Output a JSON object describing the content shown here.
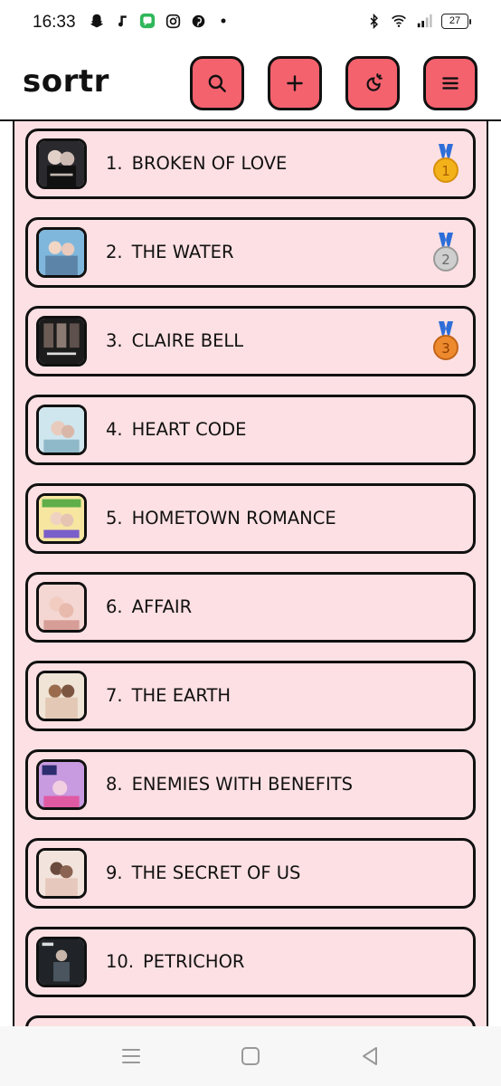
{
  "status": {
    "time": "16:33",
    "battery": "27",
    "left_icons": [
      "snapchat-icon",
      "music-note-icon",
      "messages-icon",
      "instagram-icon",
      "pinterest-icon",
      "dot-icon"
    ],
    "right_icons": [
      "bluetooth-icon",
      "wifi-icon",
      "signal-icon",
      "battery-icon"
    ]
  },
  "header": {
    "logo": "sortr",
    "buttons": [
      "search-icon",
      "plus-icon",
      "theme-icon",
      "menu-icon"
    ],
    "accent": "#f4626e"
  },
  "list": {
    "background": "#fde0e3",
    "items": [
      {
        "rank": "1.",
        "title": "BROKEN OF LOVE",
        "medal": "gold-medal-icon"
      },
      {
        "rank": "2.",
        "title": "THE WATER",
        "medal": "silver-medal-icon"
      },
      {
        "rank": "3.",
        "title": "CLAIRE BELL",
        "medal": "bronze-medal-icon"
      },
      {
        "rank": "4.",
        "title": "HEART CODE",
        "medal": ""
      },
      {
        "rank": "5.",
        "title": "HOMETOWN ROMANCE",
        "medal": ""
      },
      {
        "rank": "6.",
        "title": "AFFAIR",
        "medal": ""
      },
      {
        "rank": "7.",
        "title": "THE EARTH",
        "medal": ""
      },
      {
        "rank": "8.",
        "title": "ENEMIES WITH BENEFITS",
        "medal": ""
      },
      {
        "rank": "9.",
        "title": "THE SECRET OF US",
        "medal": ""
      },
      {
        "rank": "10.",
        "title": "PETRICHOR",
        "medal": ""
      }
    ]
  },
  "navbar": {
    "buttons": [
      "recents-icon",
      "home-icon",
      "back-icon"
    ]
  }
}
